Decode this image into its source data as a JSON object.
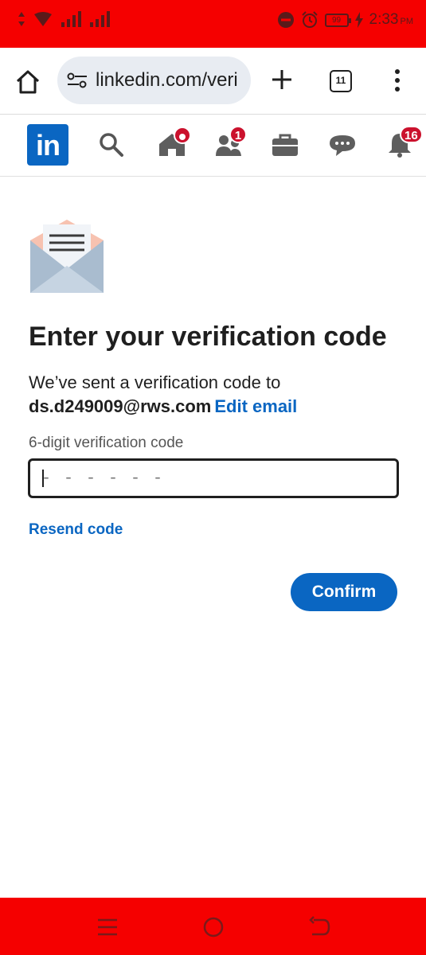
{
  "status_bar": {
    "time": "2:33",
    "ampm": "PM",
    "battery": "99"
  },
  "browser": {
    "url": "linkedin.com/veri",
    "tab_count": "11"
  },
  "nav": {
    "network_badge": "1",
    "notifications_badge": "16"
  },
  "main": {
    "title": "Enter your verification code",
    "sent_text": "We’ve sent a verification code to",
    "email": "ds.d249009@rws.com",
    "edit_email_label": "Edit email",
    "field_label": "6-digit verification code",
    "code_placeholder": "- - - - - -",
    "resend_label": "Resend code",
    "confirm_label": "Confirm"
  },
  "colors": {
    "linkedin_blue": "#0a66c2",
    "status_red": "#f50000",
    "badge_red": "#cb112d"
  }
}
